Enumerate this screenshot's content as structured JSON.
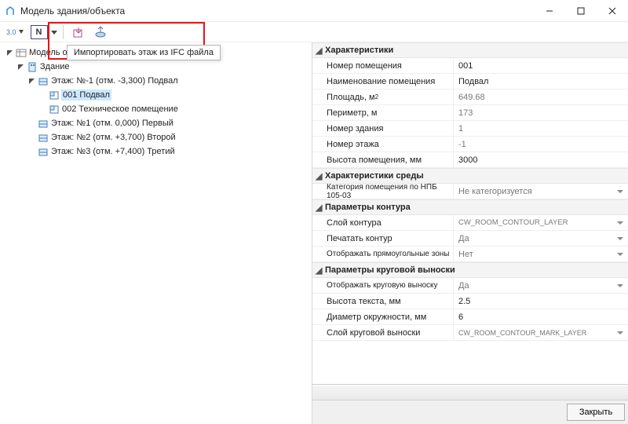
{
  "window": {
    "title": "Модель здания/объекта"
  },
  "tooltip": "Импортировать этаж из IFC файла",
  "tree": {
    "root_label": "Модель объекта",
    "building_label": "Здание",
    "floors": [
      {
        "label": "Этаж: №-1 (отм. -3,300) Подвал",
        "expanded": true,
        "rooms": [
          {
            "label": "001 Подвал",
            "selected": true
          },
          {
            "label": "002 Техническое помещение",
            "selected": false
          }
        ]
      },
      {
        "label": "Этаж: №1 (отм. 0,000) Первый",
        "expanded": false
      },
      {
        "label": "Этаж: №2 (отм. +3,700) Второй",
        "expanded": false
      },
      {
        "label": "Этаж: №3 (отм. +7,400) Третий",
        "expanded": false
      }
    ]
  },
  "props": {
    "cat_characteristics": "Характеристики",
    "room_number_label": "Номер помещения",
    "room_number_value": "001",
    "room_name_label": "Наименование помещения",
    "room_name_value": "Подвал",
    "area_label": "Площадь, м",
    "area_value": "649.68",
    "perimeter_label": "Периметр, м",
    "perimeter_value": "173",
    "building_num_label": "Номер здания",
    "building_num_value": "1",
    "floor_num_label": "Номер этажа",
    "floor_num_value": "-1",
    "room_height_label": "Высота помещения, мм",
    "room_height_value": "3000",
    "cat_env": "Характеристики среды",
    "category_label": "Категория помещения по НПБ 105-03",
    "category_value": "Не категоризуется",
    "cat_contour": "Параметры контура",
    "contour_layer_label": "Слой контура",
    "contour_layer_value": "CW_ROOM_CONTOUR_LAYER",
    "print_contour_label": "Печатать контур",
    "print_contour_value": "Да",
    "show_rect_label": "Отображать прямоугольные зоны",
    "show_rect_value": "Нет",
    "cat_callout": "Параметры круговой выноски",
    "show_callout_label": "Отображать круговую выноску",
    "show_callout_value": "Да",
    "text_height_label": "Высота текста, мм",
    "text_height_value": "2.5",
    "circle_diam_label": "Диаметр окружности, мм",
    "circle_diam_value": "6",
    "callout_layer_label": "Слой круговой выноски",
    "callout_layer_value": "CW_ROOM_CONTOUR_MARK_LAYER"
  },
  "buttons": {
    "close": "Закрыть"
  },
  "toolbar_labels": {
    "version": "3.0",
    "n_label": "N"
  }
}
